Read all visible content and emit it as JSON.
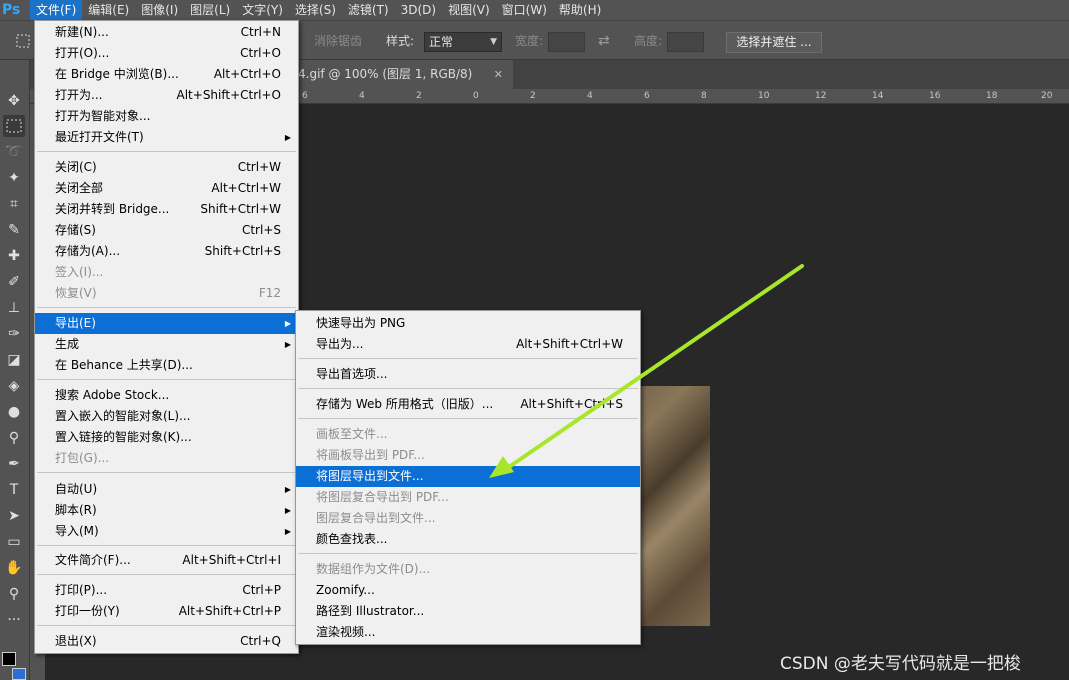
{
  "app": {
    "logo": "Ps"
  },
  "menubar": {
    "items": [
      "文件(F)",
      "编辑(E)",
      "图像(I)",
      "图层(L)",
      "文字(Y)",
      "选择(S)",
      "滤镜(T)",
      "3D(D)",
      "视图(V)",
      "窗口(W)",
      "帮助(H)"
    ]
  },
  "options": {
    "antialias": "消除锯齿",
    "style_label": "样式:",
    "style_value": "正常",
    "width_label": "宽度:",
    "height_label": "高度:",
    "select_mask_button": "选择并遮住 ..."
  },
  "document": {
    "tab_title": "4.gif @ 100% (图层 1, RGB/8)"
  },
  "ruler": {
    "labels": [
      "6",
      "4",
      "2",
      "0",
      "2",
      "4",
      "6",
      "8",
      "10",
      "12",
      "14",
      "16",
      "18",
      "20"
    ]
  },
  "file_menu": {
    "items": [
      {
        "label": "新建(N)...",
        "shortcut": "Ctrl+N"
      },
      {
        "label": "打开(O)...",
        "shortcut": "Ctrl+O"
      },
      {
        "label": "在 Bridge 中浏览(B)...",
        "shortcut": "Alt+Ctrl+O"
      },
      {
        "label": "打开为...",
        "shortcut": "Alt+Shift+Ctrl+O"
      },
      {
        "label": "打开为智能对象...",
        "shortcut": ""
      },
      {
        "label": "最近打开文件(T)",
        "shortcut": ""
      },
      {
        "label": "关闭(C)",
        "shortcut": "Ctrl+W"
      },
      {
        "label": "关闭全部",
        "shortcut": "Alt+Ctrl+W"
      },
      {
        "label": "关闭并转到 Bridge...",
        "shortcut": "Shift+Ctrl+W"
      },
      {
        "label": "存储(S)",
        "shortcut": "Ctrl+S"
      },
      {
        "label": "存储为(A)...",
        "shortcut": "Shift+Ctrl+S"
      },
      {
        "label": "签入(I)...",
        "shortcut": ""
      },
      {
        "label": "恢复(V)",
        "shortcut": "F12"
      },
      {
        "label": "导出(E)",
        "shortcut": ""
      },
      {
        "label": "生成",
        "shortcut": ""
      },
      {
        "label": "在 Behance 上共享(D)...",
        "shortcut": ""
      },
      {
        "label": "搜索 Adobe Stock...",
        "shortcut": ""
      },
      {
        "label": "置入嵌入的智能对象(L)...",
        "shortcut": ""
      },
      {
        "label": "置入链接的智能对象(K)...",
        "shortcut": ""
      },
      {
        "label": "打包(G)...",
        "shortcut": ""
      },
      {
        "label": "自动(U)",
        "shortcut": ""
      },
      {
        "label": "脚本(R)",
        "shortcut": ""
      },
      {
        "label": "导入(M)",
        "shortcut": ""
      },
      {
        "label": "文件简介(F)...",
        "shortcut": "Alt+Shift+Ctrl+I"
      },
      {
        "label": "打印(P)...",
        "shortcut": "Ctrl+P"
      },
      {
        "label": "打印一份(Y)",
        "shortcut": "Alt+Shift+Ctrl+P"
      },
      {
        "label": "退出(X)",
        "shortcut": "Ctrl+Q"
      }
    ]
  },
  "export_menu": {
    "items": [
      {
        "label": "快速导出为 PNG",
        "shortcut": ""
      },
      {
        "label": "导出为...",
        "shortcut": "Alt+Shift+Ctrl+W"
      },
      {
        "label": "导出首选项...",
        "shortcut": ""
      },
      {
        "label": "存储为 Web 所用格式（旧版）...",
        "shortcut": "Alt+Shift+Ctrl+S"
      },
      {
        "label": "画板至文件...",
        "shortcut": ""
      },
      {
        "label": "将画板导出到 PDF...",
        "shortcut": ""
      },
      {
        "label": "将图层导出到文件...",
        "shortcut": ""
      },
      {
        "label": "将图层复合导出到 PDF...",
        "shortcut": ""
      },
      {
        "label": "图层复合导出到文件...",
        "shortcut": ""
      },
      {
        "label": "颜色查找表...",
        "shortcut": ""
      },
      {
        "label": "数据组作为文件(D)...",
        "shortcut": ""
      },
      {
        "label": "Zoomify...",
        "shortcut": ""
      },
      {
        "label": "路径到 Illustrator...",
        "shortcut": ""
      },
      {
        "label": "渲染视频...",
        "shortcut": ""
      }
    ]
  },
  "colors": {
    "highlight": "#0b6fd6",
    "annotation_arrow": "#a8e62a",
    "logo": "#31a8ff"
  },
  "watermark": "CSDN @老夫写代码就是一把梭"
}
